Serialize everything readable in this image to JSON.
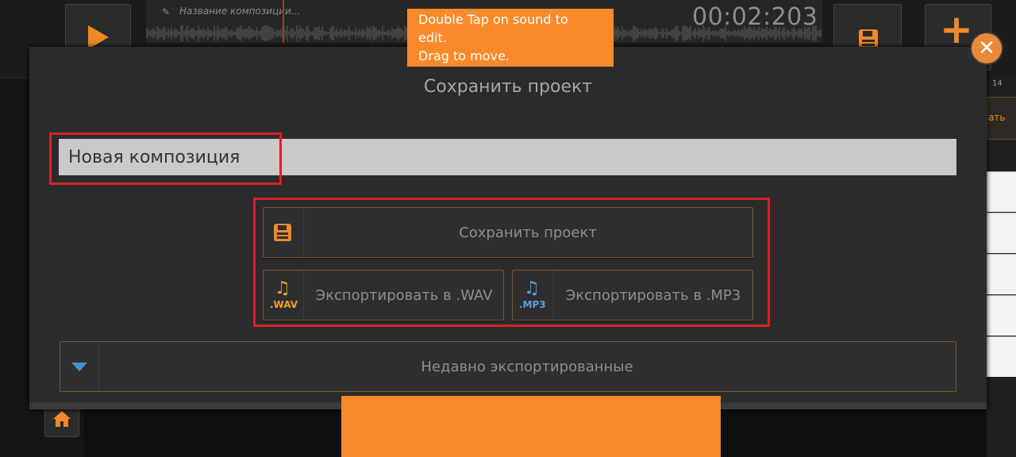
{
  "topbar": {
    "composition_name_placeholder": "Название композиции...",
    "time": "00:02:203"
  },
  "right_strip": {
    "tab_label": "вать",
    "timeline_number": "14"
  },
  "tooltip": {
    "line1": "Double Tap on sound to",
    "line2": "edit.",
    "line3": "Drag to move."
  },
  "modal": {
    "title": "Сохранить проект",
    "name_value": "Новая композиция",
    "save_label": "Сохранить проект",
    "wav_label": "Экспортировать в .WAV",
    "wav_format": ".WAV",
    "mp3_label": "Экспортировать в .MP3",
    "mp3_format": ".MP3",
    "recent_label": "Недавно экспортированные",
    "close_symbol": "✕"
  },
  "icons": {
    "play": "play-icon",
    "save": "floppy-disk-icon",
    "add": "plus-icon",
    "close": "close-icon",
    "music_note": "music-note-icon",
    "dropdown": "triangle-down-icon",
    "home": "home-icon",
    "pencil": "pencil-icon"
  },
  "colors": {
    "accent": "#fd8a2a",
    "highlight_box": "#d8202a",
    "wav_icon": "#f0a030",
    "mp3_icon": "#5aa0e0",
    "dropdown_icon": "#4a90d9"
  }
}
